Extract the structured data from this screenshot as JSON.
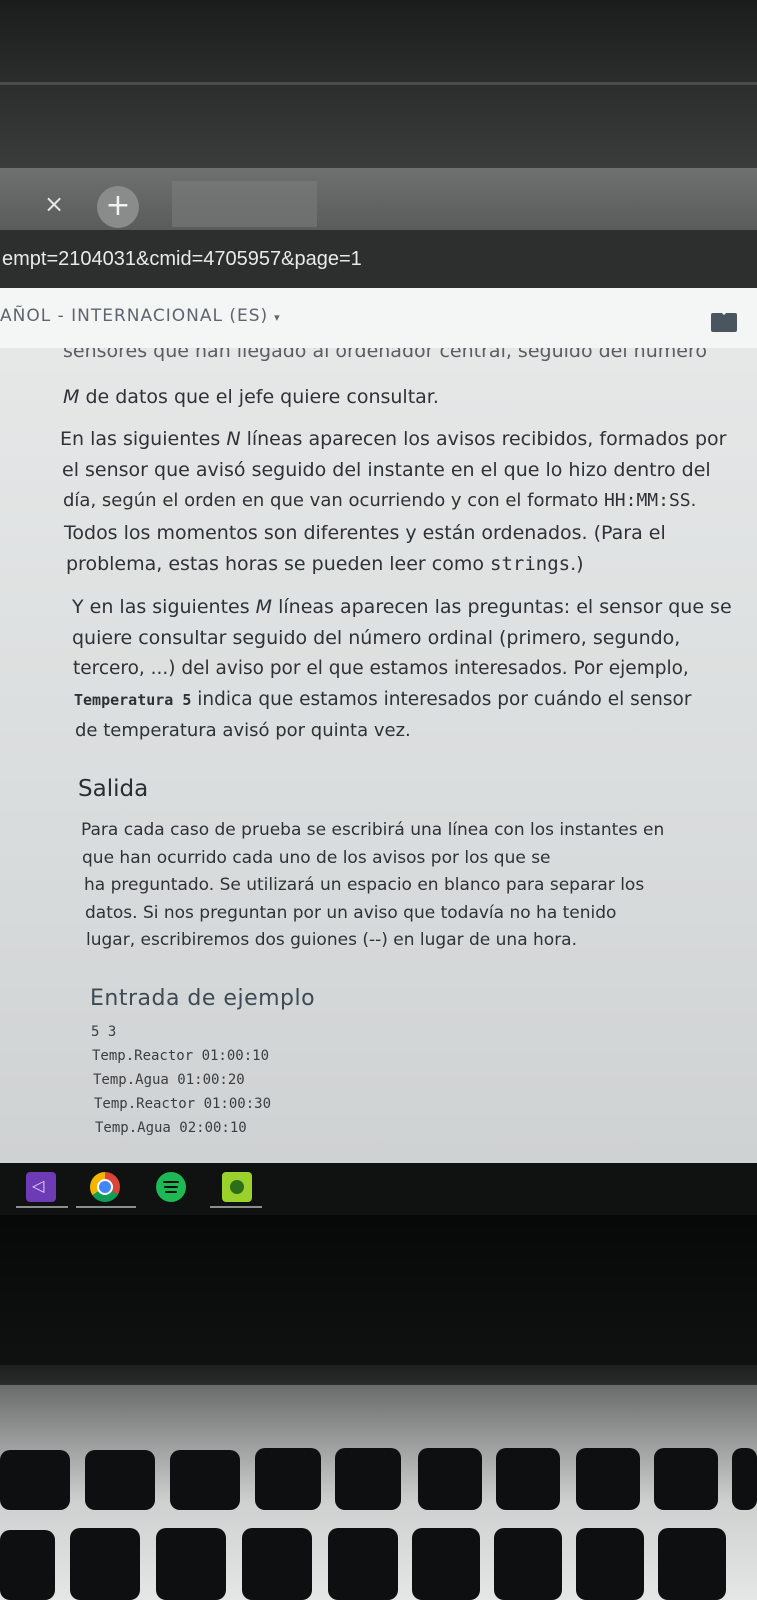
{
  "browser": {
    "tab_close": "×",
    "new_tab": "+",
    "address_url_fragment": "empt=2104031&cmid=4705957&page=1"
  },
  "header": {
    "language": "AÑOL - INTERNACIONAL (ES)",
    "language_caret": "▾"
  },
  "document": {
    "cut_line": "sensores que han llegado al ordenador central, seguido del número",
    "input_paragraphs": {
      "p1": {
        "l1_var": "M",
        "l1_rest": " de datos que el jefe quiere consultar."
      },
      "p2": {
        "l1_a": "En las siguientes ",
        "l1_var": "N",
        "l1_b": " líneas aparecen los avisos recibidos, formados por",
        "l2": "el sensor que avisó seguido del instante en el que lo hizo dentro del",
        "l3_a": "día, según el orden en que van ocurriendo y con el formato ",
        "l3_code": "HH:MM:SS",
        "l3_b": ".",
        "l4": "Todos los momentos son diferentes y están ordenados. (Para el",
        "l5_a": "problema, estas horas se pueden leer como ",
        "l5_code": "strings",
        "l5_b": ".)"
      },
      "p3": {
        "l1_a": "Y en las siguientes ",
        "l1_var": "M",
        "l1_b": " líneas aparecen las preguntas: el sensor que se",
        "l2": "quiere consultar seguido del número ordinal (primero, segundo,",
        "l3": "tercero, ...) del aviso por el que estamos interesados. Por ejemplo,",
        "l4_code": "Temperatura 5",
        "l4_b": " indica que estamos interesados por cuándo el sensor",
        "l5": "de temperatura avisó por quinta vez."
      }
    },
    "output_section": {
      "title": "Salida",
      "lines": [
        "Para cada caso de prueba se escribirá una línea con los instantes en",
        "que han ocurrido cada uno de los avisos por los que se",
        "ha preguntado. Se utilizará un espacio en blanco para separar los",
        "datos. Si nos preguntan por un aviso que todavía no ha tenido",
        "lugar, escribiremos dos guiones (--) en lugar de una hora."
      ]
    },
    "example_section": {
      "title": "Entrada de ejemplo",
      "code_lines": [
        "5 3",
        "Temp.Reactor 01:00:10",
        "Temp.Agua 01:00:20",
        "Temp.Reactor 01:00:30",
        "Temp.Agua 02:00:10"
      ]
    }
  },
  "taskbar": {
    "icons": [
      "visual-studio-icon",
      "chrome-icon",
      "spotify-icon",
      "app-icon"
    ]
  }
}
